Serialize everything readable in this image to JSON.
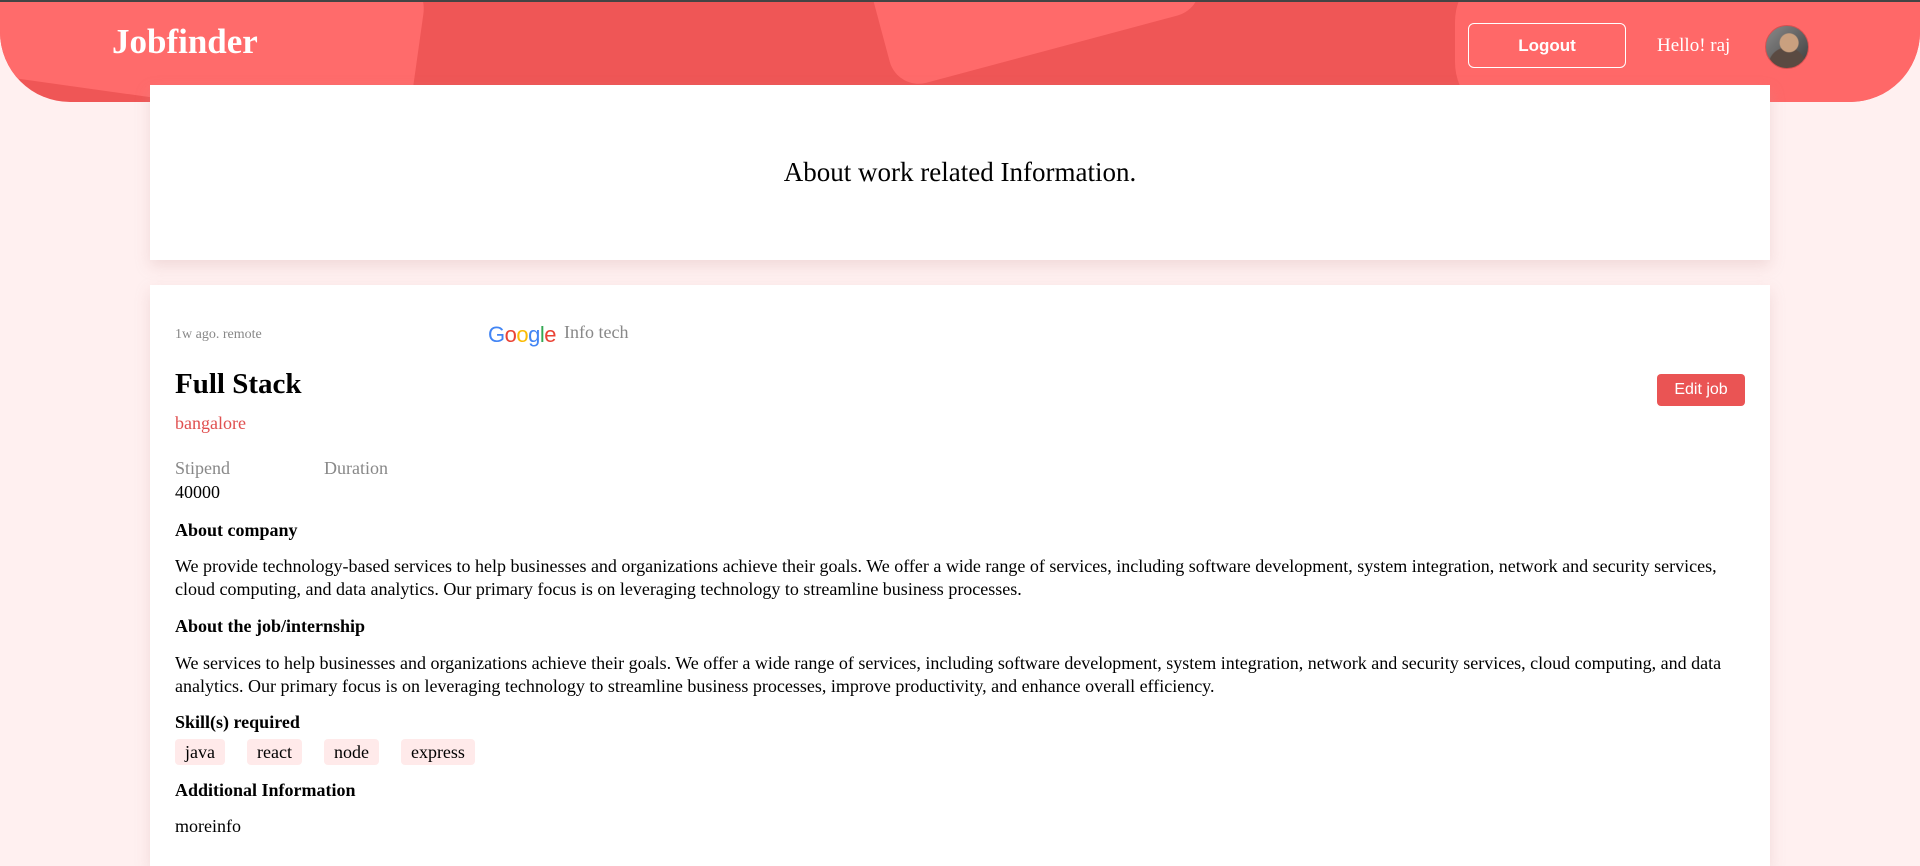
{
  "header": {
    "brand": "Jobfinder",
    "logout_label": "Logout",
    "greeting": "Hello! raj"
  },
  "info_card": {
    "title": "About work related Information."
  },
  "job": {
    "posted": "1w ago. remote",
    "company_logo_text": "Google",
    "company_name": "Info tech",
    "title": "Full Stack",
    "location": "bangalore",
    "edit_label": "Edit job",
    "stipend_label": "Stipend",
    "duration_label": "Duration",
    "stipend_value": "40000",
    "about_company_heading": "About company",
    "about_company_text": "We provide technology-based services to help businesses and organizations achieve their goals. We offer a wide range of services, including software development, system integration, network and security services, cloud computing, and data analytics. Our primary focus is on leveraging technology to streamline business processes.",
    "about_job_heading": "About the job/internship",
    "about_job_text": "We services to help businesses and organizations achieve their goals. We offer a wide range of services, including software development, system integration, network and security services, cloud computing, and data analytics. Our primary focus is on leveraging technology to streamline business processes, improve productivity, and enhance overall efficiency.",
    "skills_heading": "Skill(s) required",
    "skills": [
      "java",
      "react",
      "node",
      "express"
    ],
    "additional_heading": "Additional Information",
    "additional_text": "moreinfo"
  },
  "colors": {
    "header_bg": "#ef5656",
    "page_bg": "#fff0f0",
    "accent": "#ea5454",
    "skill_bg": "#ffeaea"
  },
  "icons": {
    "avatar": "user-avatar-photo",
    "company_logo": "google-logo"
  }
}
